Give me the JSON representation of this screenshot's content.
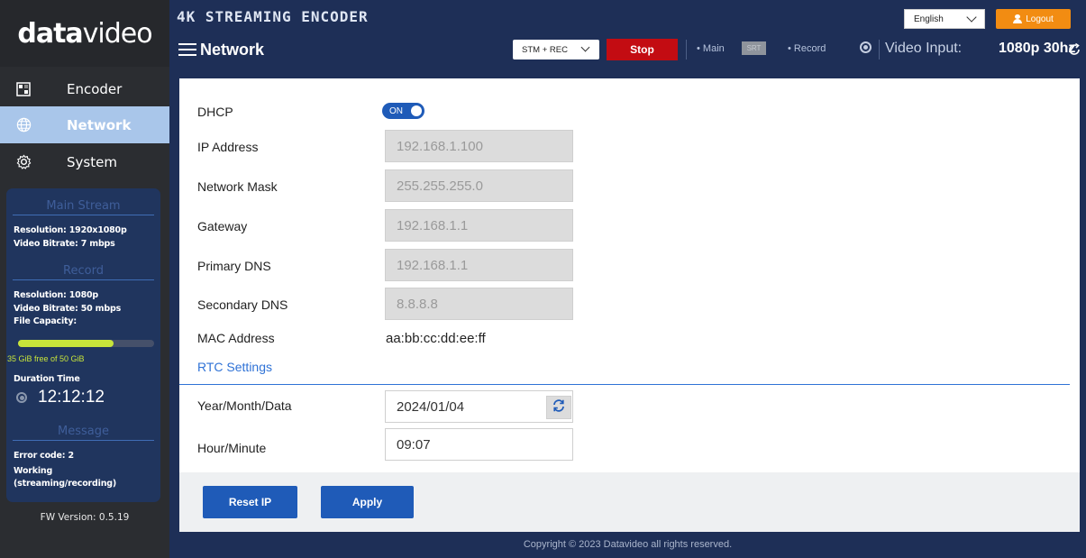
{
  "sidebar": {
    "logo_bold": "data",
    "logo_light": "video",
    "nav": [
      {
        "label": "Encoder",
        "icon": "encoder-icon"
      },
      {
        "label": "Network",
        "icon": "globe-icon",
        "active": true
      },
      {
        "label": "System",
        "icon": "gear-icon"
      }
    ],
    "status": {
      "main_stream_title": "Main Stream",
      "main_resolution": "Resolution: 1920x1080p",
      "main_bitrate": "Video Bitrate: 7 mbps",
      "record_title": "Record",
      "record_resolution": "Resolution: 1080p",
      "record_bitrate": "Video Bitrate: 50 mbps",
      "file_capacity_label": "File Capacity:",
      "capacity_used_fraction": 0.7,
      "capacity_text": "35 GiB free of 50 GiB",
      "duration_label": "Duration Time",
      "duration_value": "12:12:12",
      "message_title": "Message",
      "error_code": "Error code: 2",
      "working": "Working",
      "working_detail": "(streaming/recording)"
    },
    "fw_version": "FW Version: 0.5.19"
  },
  "header": {
    "app_title": "4K STREAMING ENCODER",
    "page_title": "Network",
    "language": "English",
    "logout_label": "Logout",
    "mode": "STM + REC",
    "stop_label": "Stop",
    "main_label": "• Main",
    "srt_badge": "SRT",
    "record_label": "• Record",
    "video_input_label": "Video Input:",
    "video_input_value": "1080p 30hz"
  },
  "network": {
    "dhcp_label": "DHCP",
    "dhcp_state": "ON",
    "ip_label": "IP Address",
    "ip_value": "192.168.1.100",
    "mask_label": "Network Mask",
    "mask_value": "255.255.255.0",
    "gateway_label": "Gateway",
    "gateway_value": "192.168.1.1",
    "dns1_label": "Primary DNS",
    "dns1_value": "192.168.1.1",
    "dns2_label": "Secondary DNS",
    "dns2_value": "8.8.8.8",
    "mac_label": "MAC Address",
    "mac_value": "aa:bb:cc:dd:ee:ff",
    "rtc_title": "RTC Settings",
    "date_label": "Year/Month/Data",
    "date_value": "2024/01/04",
    "time_label": "Hour/Minute",
    "time_value": "09:07",
    "reset_label": "Reset IP",
    "apply_label": "Apply"
  },
  "footer": {
    "copyright": "Copyright © 2023 Datavideo all rights reserved."
  },
  "colors": {
    "navy": "#1e2f57",
    "sidebar": "#2b2d31",
    "active_nav": "#a9c6ea",
    "primary_blue": "#1f5bb8",
    "stop_red": "#c30c12",
    "logout_orange": "#f28c12",
    "capacity_green": "#c7e43a"
  }
}
